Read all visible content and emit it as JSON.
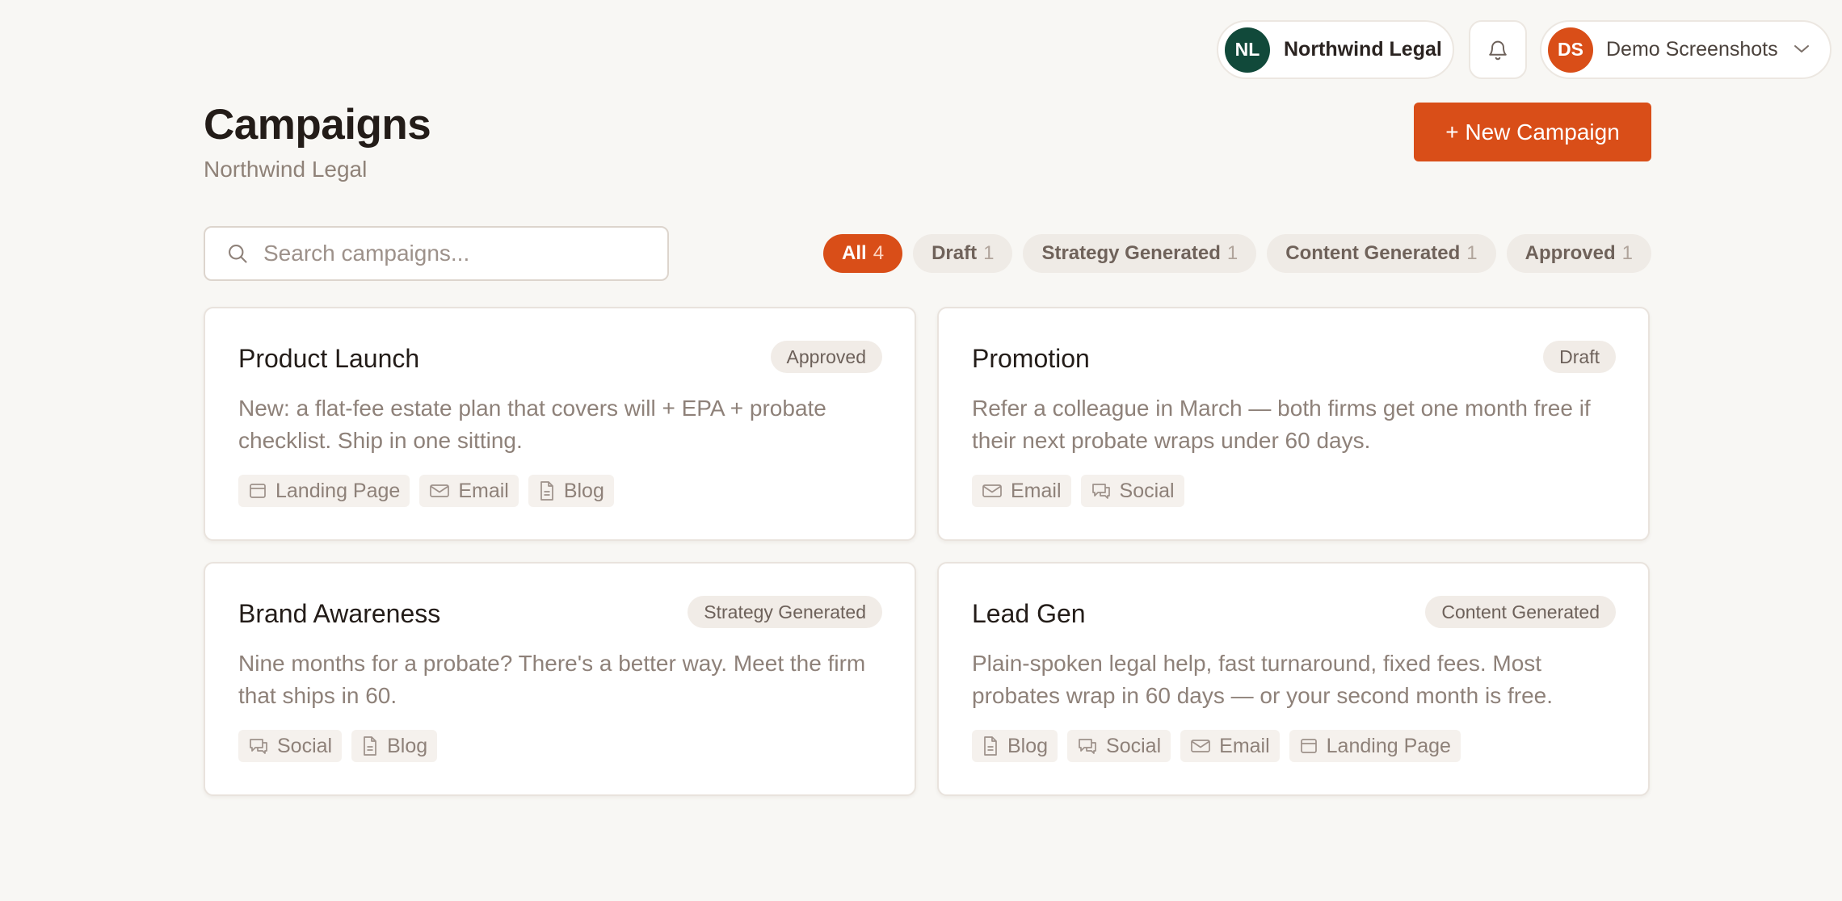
{
  "topbar": {
    "org": {
      "initials": "NL",
      "name": "Northwind Legal",
      "avatar_color": "#11493a"
    },
    "user": {
      "initials": "DS",
      "name": "Demo Screenshots",
      "avatar_color": "#d94e18"
    },
    "bell_icon": "bell-icon",
    "chevron_icon": "chevron-down-icon"
  },
  "header": {
    "title": "Campaigns",
    "subtitle": "Northwind Legal",
    "new_button": "+ New Campaign"
  },
  "search": {
    "placeholder": "Search campaigns...",
    "value": ""
  },
  "filters": [
    {
      "label": "All",
      "count": "4",
      "active": true
    },
    {
      "label": "Draft",
      "count": "1",
      "active": false
    },
    {
      "label": "Strategy Generated",
      "count": "1",
      "active": false
    },
    {
      "label": "Content Generated",
      "count": "1",
      "active": false
    },
    {
      "label": "Approved",
      "count": "1",
      "active": false
    }
  ],
  "campaigns": [
    {
      "title": "Product Launch",
      "status": "Approved",
      "description": "New: a flat-fee estate plan that covers will + EPA + probate checklist. Ship in one sitting.",
      "channels": [
        {
          "label": "Landing Page",
          "icon": "landing-page-icon"
        },
        {
          "label": "Email",
          "icon": "email-icon"
        },
        {
          "label": "Blog",
          "icon": "blog-icon"
        }
      ]
    },
    {
      "title": "Promotion",
      "status": "Draft",
      "description": "Refer a colleague in March — both firms get one month free if their next probate wraps under 60 days.",
      "channels": [
        {
          "label": "Email",
          "icon": "email-icon"
        },
        {
          "label": "Social",
          "icon": "social-icon"
        }
      ]
    },
    {
      "title": "Brand Awareness",
      "status": "Strategy Generated",
      "description": "Nine months for a probate? There's a better way. Meet the firm that ships in 60.",
      "channels": [
        {
          "label": "Social",
          "icon": "social-icon"
        },
        {
          "label": "Blog",
          "icon": "blog-icon"
        }
      ]
    },
    {
      "title": "Lead Gen",
      "status": "Content Generated",
      "description": "Plain-spoken legal help, fast turnaround, fixed fees. Most probates wrap in 60 days — or your second month is free.",
      "channels": [
        {
          "label": "Blog",
          "icon": "blog-icon"
        },
        {
          "label": "Social",
          "icon": "social-icon"
        },
        {
          "label": "Email",
          "icon": "email-icon"
        },
        {
          "label": "Landing Page",
          "icon": "landing-page-icon"
        }
      ]
    }
  ]
}
